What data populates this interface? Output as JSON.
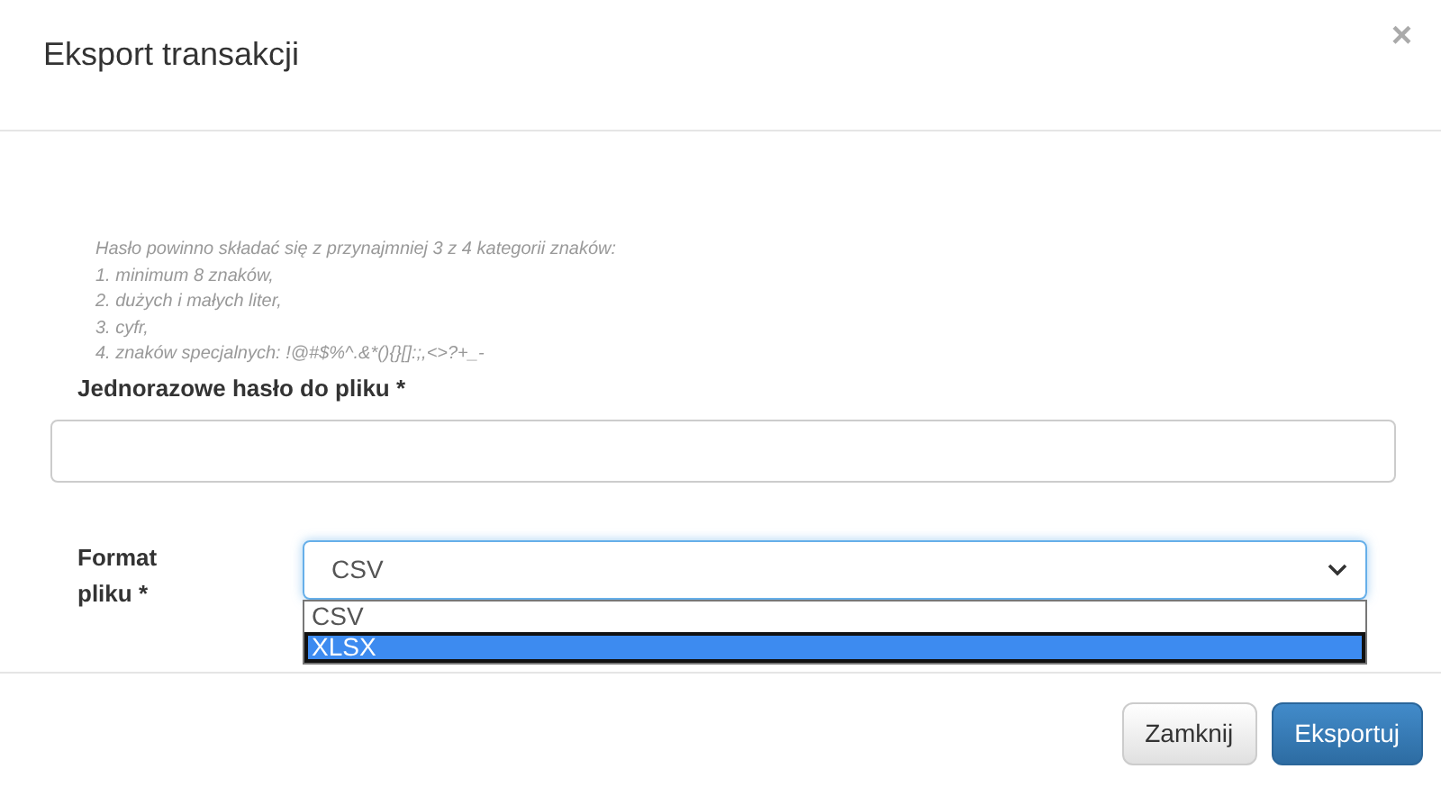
{
  "dialog": {
    "title": "Eksport transakcji",
    "close": "×"
  },
  "password_hint": [
    "Hasło powinno składać się z przynajmniej 3 z 4 kategorii znaków:",
    "1. minimum 8 znaków,",
    "2. dużych i małych liter,",
    "3. cyfr,",
    "4. znaków specjalnych: !@#$%^.&*(){}[]:;,<>?+_-"
  ],
  "password_field": {
    "label": "Jednorazowe hasło do pliku *"
  },
  "format_field": {
    "label": "Format pliku *",
    "value": "CSV",
    "expanded": true,
    "options": [
      {
        "label": "CSV",
        "selected": true,
        "highlighted": false
      },
      {
        "label": "XLSX",
        "selected": false,
        "highlighted": true
      }
    ]
  },
  "buttons": [
    {
      "label": "Zamknij",
      "kind": "secondary"
    },
    {
      "label": "Eksportuj",
      "kind": "primary"
    }
  ]
}
